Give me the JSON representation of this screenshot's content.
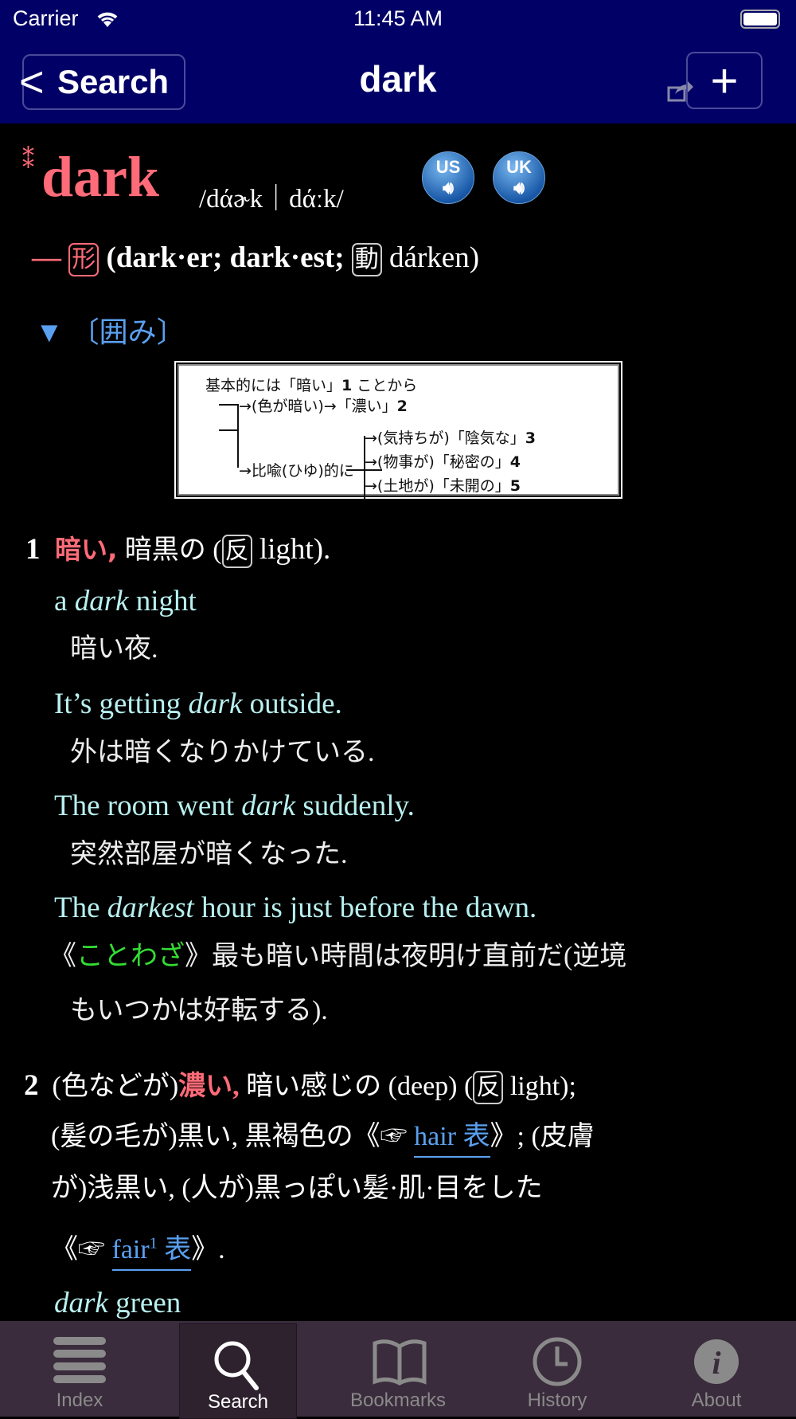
{
  "status": {
    "carrier": "Carrier",
    "time": "11:45 AM"
  },
  "nav": {
    "back": "Search",
    "title": "dark",
    "add": "+"
  },
  "entry": {
    "stars": "⁑",
    "headword": "dark",
    "pron": "/dάɚk｜dάːk/",
    "audio": [
      {
        "label": "US"
      },
      {
        "label": "UK"
      }
    ],
    "dash": "—",
    "pos": "形",
    "forms_open": "(dark·er; dark·est;",
    "verb_tag": "動",
    "verb": "dárken)",
    "box_toggle": "▼",
    "box_label": "〔囲み〕",
    "diagram": {
      "l1a": "基本的には「暗い」",
      "n1": "1",
      "l1b": "ことから",
      "l2": "→(色が暗い)→「濃い」",
      "n2": "2",
      "l3": "→(気持ちが)「陰気な」",
      "n3": "3",
      "l4a": "→比喩(ひゆ)的に",
      "l4": "→(物事が)「秘密の」",
      "n4": "4",
      "l5": "→(土地が)「未開の」",
      "n5": "5"
    },
    "sense1": {
      "num": "1",
      "key": "暗い,",
      "rest": "暗黒の (",
      "ant": "反",
      "ant_word": " light)."
    },
    "examples": [
      {
        "pre": "a ",
        "em": "dark",
        "post": "  night",
        "ja": "暗い夜."
      },
      {
        "pre": "It’s getting ",
        "em": "dark",
        "post": "  outside.",
        "ja": "外は暗くなりかけている."
      },
      {
        "pre": "The room went ",
        "em": "dark",
        "post": "  suddenly.",
        "ja": "突然部屋が暗くなった."
      },
      {
        "pre": "The ",
        "em": "darkest",
        "post": "  hour is just before the dawn.",
        "ja_open": "《",
        "ja_tag": "ことわざ",
        "ja": "》最も暗い時間は夜明け直前だ(逆境",
        "ja2": "もいつかは好転する)."
      }
    ],
    "sense2": {
      "num": "2",
      "pre": "(色などが)",
      "key": "濃い,",
      "rest": " 暗い感じの (deep) (",
      "ant": "反",
      "ant_word": " light);",
      "l2a": "(髪の毛が)黒い, 黒褐色の《☞ ",
      "link1": "hair 表",
      "l2b": "》; (皮膚",
      "l3": "が)浅黒い, (人が)黒っぽい髪·肌·目をした",
      "l4a": "《☞ ",
      "link2": "fair",
      "sup": "1",
      "link2b": " 表",
      "l4b": "》.",
      "ex_em": "dark",
      "ex_post": "  green"
    }
  },
  "tabs": [
    {
      "label": "Index",
      "icon": "list-icon"
    },
    {
      "label": "Search",
      "icon": "search-icon",
      "active": true
    },
    {
      "label": "Bookmarks",
      "icon": "book-icon"
    },
    {
      "label": "History",
      "icon": "clock-icon"
    },
    {
      "label": "About",
      "icon": "info-icon"
    }
  ],
  "colors": {
    "nav_bg": "#000066",
    "headword": "#ff6b78",
    "example": "#b8f0f0",
    "link": "#5aa0f0",
    "proverb": "#33dd33"
  }
}
